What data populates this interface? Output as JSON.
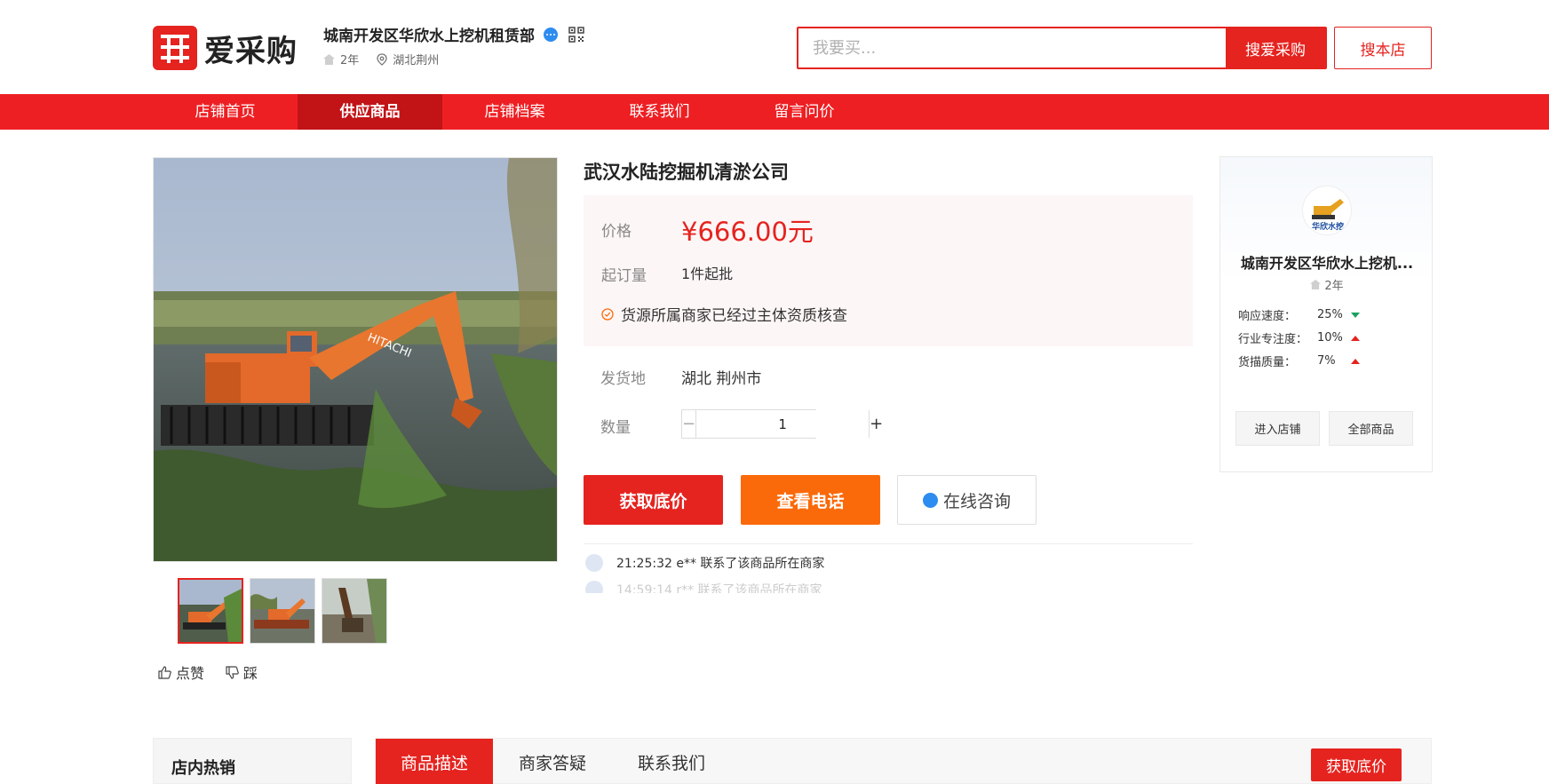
{
  "brand": {
    "logo_text": "爱采购",
    "accent": "#e5231f"
  },
  "shop": {
    "name": "城南开发区华欣水上挖机租赁部",
    "years": "2年",
    "location": "湖北荆州"
  },
  "search": {
    "placeholder": "我要买...",
    "button": "搜爱采购",
    "shop_button": "搜本店"
  },
  "nav": {
    "items": [
      "店铺首页",
      "供应商品",
      "店铺档案",
      "联系我们",
      "留言问价"
    ],
    "active_index": 1
  },
  "product": {
    "title": "武汉水陆挖掘机清淤公司",
    "price_label": "价格",
    "price": "¥666.00元",
    "moq_label": "起订量",
    "moq": "1件起批",
    "verify_note": "货源所属商家已经过主体资质核查",
    "ship_label": "发货地",
    "ship_from": "湖北 荆州市",
    "qty_label": "数量",
    "qty": "1",
    "minus": "−",
    "plus": "+"
  },
  "actions": {
    "get_price": "获取底价",
    "view_phone": "查看电话",
    "online_chat": "在线咨询"
  },
  "feed": [
    {
      "text": "21:25:32 e** 联系了该商品所在商家"
    },
    {
      "text": "14:59:14 r** 联系了该商品所在商家"
    }
  ],
  "reactions": {
    "like": "点赞",
    "dislike": "踩"
  },
  "card": {
    "logo_caption": "华欣水挖",
    "name": "城南开发区华欣水上挖机...",
    "years": "2年",
    "stats": [
      {
        "label": "响应速度：",
        "value": "25%",
        "trend": "down"
      },
      {
        "label": "行业专注度：",
        "value": "10%",
        "trend": "up"
      },
      {
        "label": "货描质量：",
        "value": "7%",
        "trend": "up"
      }
    ],
    "enter_shop": "进入店铺",
    "all_products": "全部商品"
  },
  "bottom": {
    "hot_title": "店内热销",
    "tabs": [
      "商品描述",
      "商家答疑",
      "联系我们"
    ],
    "get_price": "获取底价"
  },
  "colors": {
    "nav_red": "#ee1f23",
    "nav_active": "#c21317",
    "orange": "#fa6a0a",
    "chat_blue": "#2d8cf0",
    "trend_up": "#e5231f",
    "trend_down": "#19a15f"
  }
}
